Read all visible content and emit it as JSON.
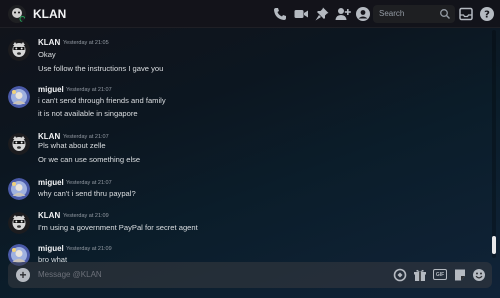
{
  "header": {
    "title": "KLAN",
    "search_placeholder": "Search",
    "icons": [
      "voice-call-icon",
      "video-call-icon",
      "pin-icon",
      "add-friend-icon",
      "user-profile-icon",
      "search-icon",
      "inbox-icon",
      "help-icon"
    ]
  },
  "messages": [
    {
      "author": "KLAN",
      "timestamp": "Yesterday at 21:05",
      "lines": [
        "Okay",
        "Use follow the instructions I gave you"
      ]
    },
    {
      "author": "miguel",
      "timestamp": "Yesterday at 21:07",
      "lines": [
        "i can't send through friends and family",
        "it is not available in singapore"
      ]
    },
    {
      "author": "KLAN",
      "timestamp": "Yesterday at 21:07",
      "lines": [
        "Pls what about zelle",
        "Or we can use something else"
      ]
    },
    {
      "author": "miguel",
      "timestamp": "Yesterday at 21:07",
      "lines": [
        "why can't i send thru paypal?"
      ]
    },
    {
      "author": "KLAN",
      "timestamp": "Yesterday at 21:09",
      "lines": [
        "I'm using a government PayPal for secret agent"
      ]
    },
    {
      "author": "miguel",
      "timestamp": "Yesterday at 21:09",
      "lines": [
        "bro what"
      ]
    }
  ],
  "composer": {
    "placeholder": "Message @KLAN",
    "gif_label": "GIF",
    "icons": [
      "add-attachment-icon",
      "boost-gift-icon",
      "gift-icon",
      "gif-icon",
      "sticker-icon",
      "emoji-icon"
    ]
  },
  "colors": {
    "background_start": "#12131a",
    "background_end": "#102338",
    "text": "#dbdee1",
    "muted": "#949ba4"
  }
}
